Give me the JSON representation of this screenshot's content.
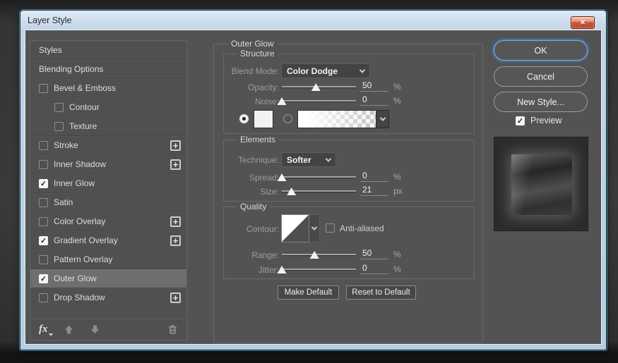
{
  "window": {
    "title": "Layer Style",
    "close_glyph": "×"
  },
  "icons": {
    "check": "✓",
    "plus": "+"
  },
  "colors": {
    "frame_blue": "#b6cde2",
    "frame_edge_cyan": "#56bad6",
    "dialog_bg": "#535353",
    "sidebar_selected": "#6e6e6e",
    "fieldset_border": "#696969",
    "label_grey": "#9d9d9d",
    "value_white": "#f0f0f0",
    "ok_focus_ring": "#79aede",
    "close_red": "#cc5634"
  },
  "sidebar": {
    "items": [
      {
        "label": "Styles",
        "has_checkbox": false,
        "checked": false,
        "indent": false,
        "has_plus": false,
        "selected": false
      },
      {
        "label": "Blending Options",
        "has_checkbox": false,
        "checked": false,
        "indent": false,
        "has_plus": false,
        "selected": false
      },
      {
        "label": "Bevel & Emboss",
        "has_checkbox": true,
        "checked": false,
        "indent": false,
        "has_plus": false,
        "selected": false
      },
      {
        "label": "Contour",
        "has_checkbox": true,
        "checked": false,
        "indent": true,
        "has_plus": false,
        "selected": false
      },
      {
        "label": "Texture",
        "has_checkbox": true,
        "checked": false,
        "indent": true,
        "has_plus": false,
        "selected": false
      },
      {
        "label": "Stroke",
        "has_checkbox": true,
        "checked": false,
        "indent": false,
        "has_plus": true,
        "selected": false
      },
      {
        "label": "Inner Shadow",
        "has_checkbox": true,
        "checked": false,
        "indent": false,
        "has_plus": true,
        "selected": false
      },
      {
        "label": "Inner Glow",
        "has_checkbox": true,
        "checked": true,
        "indent": false,
        "has_plus": false,
        "selected": false
      },
      {
        "label": "Satin",
        "has_checkbox": true,
        "checked": false,
        "indent": false,
        "has_plus": false,
        "selected": false
      },
      {
        "label": "Color Overlay",
        "has_checkbox": true,
        "checked": false,
        "indent": false,
        "has_plus": true,
        "selected": false
      },
      {
        "label": "Gradient Overlay",
        "has_checkbox": true,
        "checked": true,
        "indent": false,
        "has_plus": true,
        "selected": false
      },
      {
        "label": "Pattern Overlay",
        "has_checkbox": true,
        "checked": false,
        "indent": false,
        "has_plus": false,
        "selected": false
      },
      {
        "label": "Outer Glow",
        "has_checkbox": true,
        "checked": true,
        "indent": false,
        "has_plus": false,
        "selected": true
      },
      {
        "label": "Drop Shadow",
        "has_checkbox": true,
        "checked": false,
        "indent": false,
        "has_plus": true,
        "selected": false
      }
    ],
    "footer": {
      "fx_label": "fx"
    }
  },
  "main": {
    "panel_title": "Outer Glow",
    "structure": {
      "legend": "Structure",
      "blend_mode": {
        "label": "Blend Mode:",
        "value": "Color Dodge"
      },
      "opacity": {
        "label": "Opacity:",
        "value": "50",
        "unit": "%",
        "percent": 46
      },
      "noise": {
        "label": "Noise:",
        "value": "0",
        "unit": "%",
        "percent": 0
      }
    },
    "elements": {
      "legend": "Elements",
      "technique": {
        "label": "Technique:",
        "value": "Softer"
      },
      "spread": {
        "label": "Spread:",
        "value": "0",
        "unit": "%",
        "percent": 0
      },
      "size": {
        "label": "Size:",
        "value": "21",
        "unit": "px",
        "percent": 13
      }
    },
    "quality": {
      "legend": "Quality",
      "contour_label": "Contour:",
      "anti_aliased_label": "Anti-aliased",
      "range": {
        "label": "Range:",
        "value": "50",
        "unit": "%",
        "percent": 44
      },
      "jitter": {
        "label": "Jitter:",
        "value": "0",
        "unit": "%",
        "percent": 0
      }
    },
    "buttons": {
      "make_default": "Make Default",
      "reset_default": "Reset to Default"
    }
  },
  "actions": {
    "ok": "OK",
    "cancel": "Cancel",
    "new_style": "New Style...",
    "preview_label": "Preview"
  }
}
